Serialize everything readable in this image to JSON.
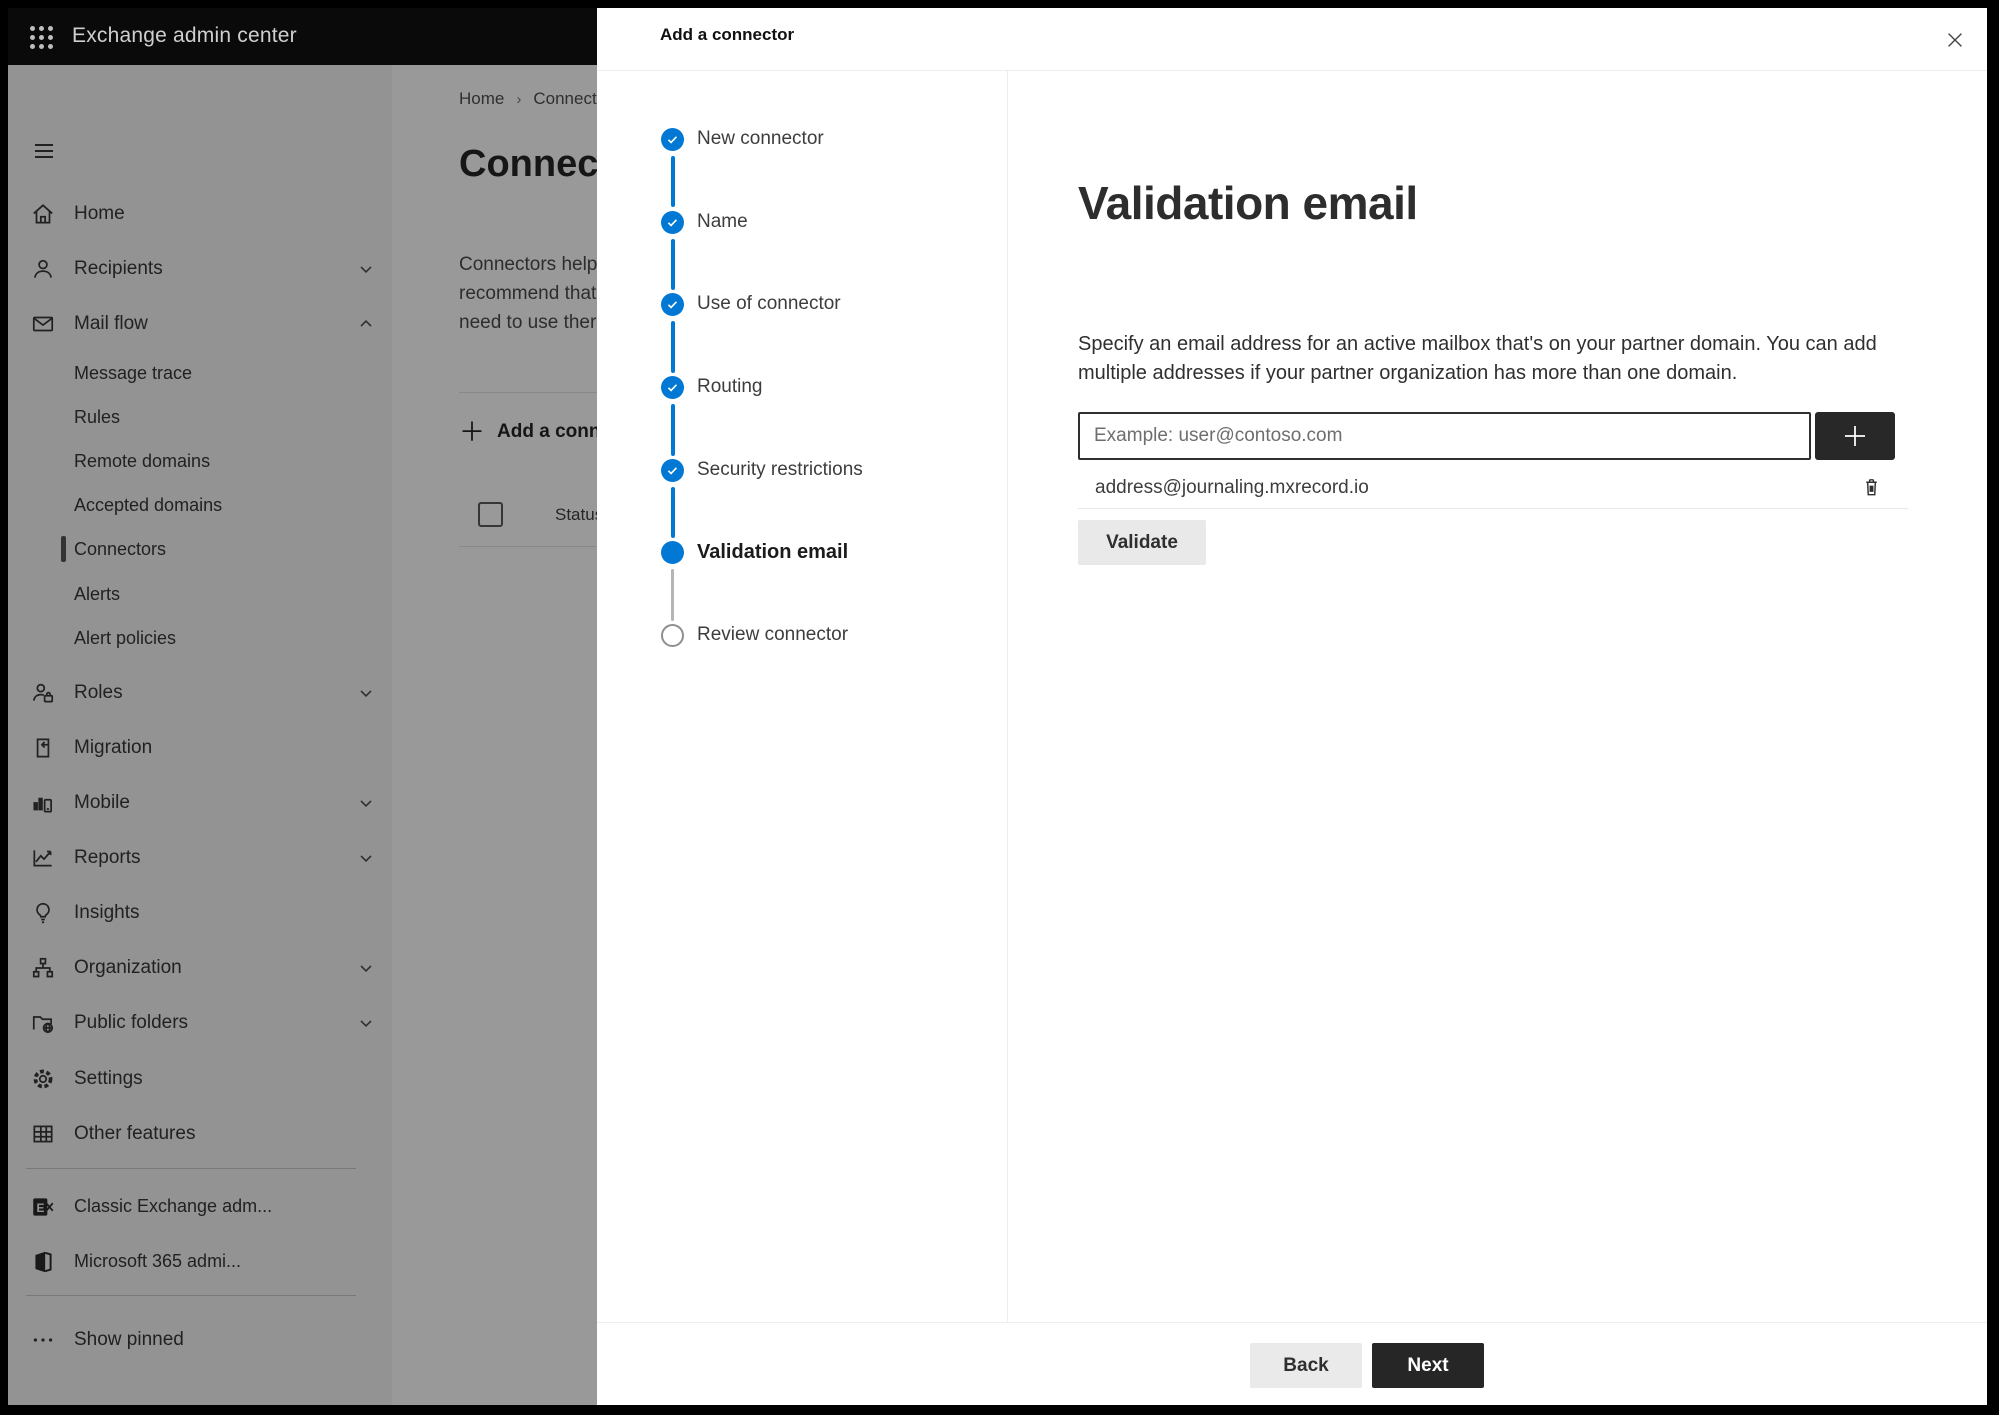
{
  "header": {
    "title": "Exchange admin center"
  },
  "sidebar": {
    "items": [
      {
        "label": "Home",
        "icon": "home-icon"
      },
      {
        "label": "Recipients",
        "icon": "person-icon",
        "chevron": "down"
      },
      {
        "label": "Mail flow",
        "icon": "mail-icon",
        "chevron": "up",
        "expanded": true
      },
      {
        "label": "Message trace",
        "sub": true
      },
      {
        "label": "Rules",
        "sub": true
      },
      {
        "label": "Remote domains",
        "sub": true
      },
      {
        "label": "Accepted domains",
        "sub": true
      },
      {
        "label": "Connectors",
        "sub": true,
        "selected": true
      },
      {
        "label": "Alerts",
        "sub": true
      },
      {
        "label": "Alert policies",
        "sub": true
      },
      {
        "label": "Roles",
        "icon": "roles-icon",
        "chevron": "down"
      },
      {
        "label": "Migration",
        "icon": "migration-icon"
      },
      {
        "label": "Mobile",
        "icon": "mobile-icon",
        "chevron": "down"
      },
      {
        "label": "Reports",
        "icon": "reports-icon",
        "chevron": "down"
      },
      {
        "label": "Insights",
        "icon": "lightbulb-icon"
      },
      {
        "label": "Organization",
        "icon": "org-icon",
        "chevron": "down"
      },
      {
        "label": "Public folders",
        "icon": "folder-globe-icon",
        "chevron": "down"
      },
      {
        "label": "Settings",
        "icon": "gear-icon"
      },
      {
        "label": "Other features",
        "icon": "grid-icon"
      },
      {
        "label": "Classic Exchange adm...",
        "icon": "exchange-logo-icon"
      },
      {
        "label": "Microsoft 365 admi...",
        "icon": "office-logo-icon"
      },
      {
        "label": "Show pinned",
        "icon": "ellipsis-icon"
      }
    ]
  },
  "background_page": {
    "breadcrumb": {
      "home": "Home",
      "current": "Connectors"
    },
    "title": "Connectors",
    "body_lines": "Connectors help\nrecommend that\nneed to use ther",
    "add_button_label": "Add a connector",
    "table": {
      "status_header": "Status"
    }
  },
  "panel": {
    "title": "Add a connector",
    "steps": [
      {
        "label": "New connector",
        "state": "completed"
      },
      {
        "label": "Name",
        "state": "completed"
      },
      {
        "label": "Use of connector",
        "state": "completed"
      },
      {
        "label": "Routing",
        "state": "completed"
      },
      {
        "label": "Security restrictions",
        "state": "completed"
      },
      {
        "label": "Validation email",
        "state": "current"
      },
      {
        "label": "Review connector",
        "state": "upcoming"
      }
    ],
    "content": {
      "heading": "Validation email",
      "description": "Specify an email address for an active mailbox that's on your partner domain. You can add multiple addresses if your partner organization has more than one domain.",
      "input_placeholder": "Example: user@contoso.com",
      "input_value": "",
      "added_address": "address@journaling.mxrecord.io",
      "validate_label": "Validate"
    },
    "footer": {
      "back_label": "Back",
      "next_label": "Next"
    }
  },
  "colors": {
    "accent_blue": "#0078d4",
    "header_bg": "#0a0a0a",
    "next_button_bg": "#262626",
    "neutral_button_bg": "#eaeaea",
    "overlay": "rgba(0,0,0,0.40)"
  }
}
